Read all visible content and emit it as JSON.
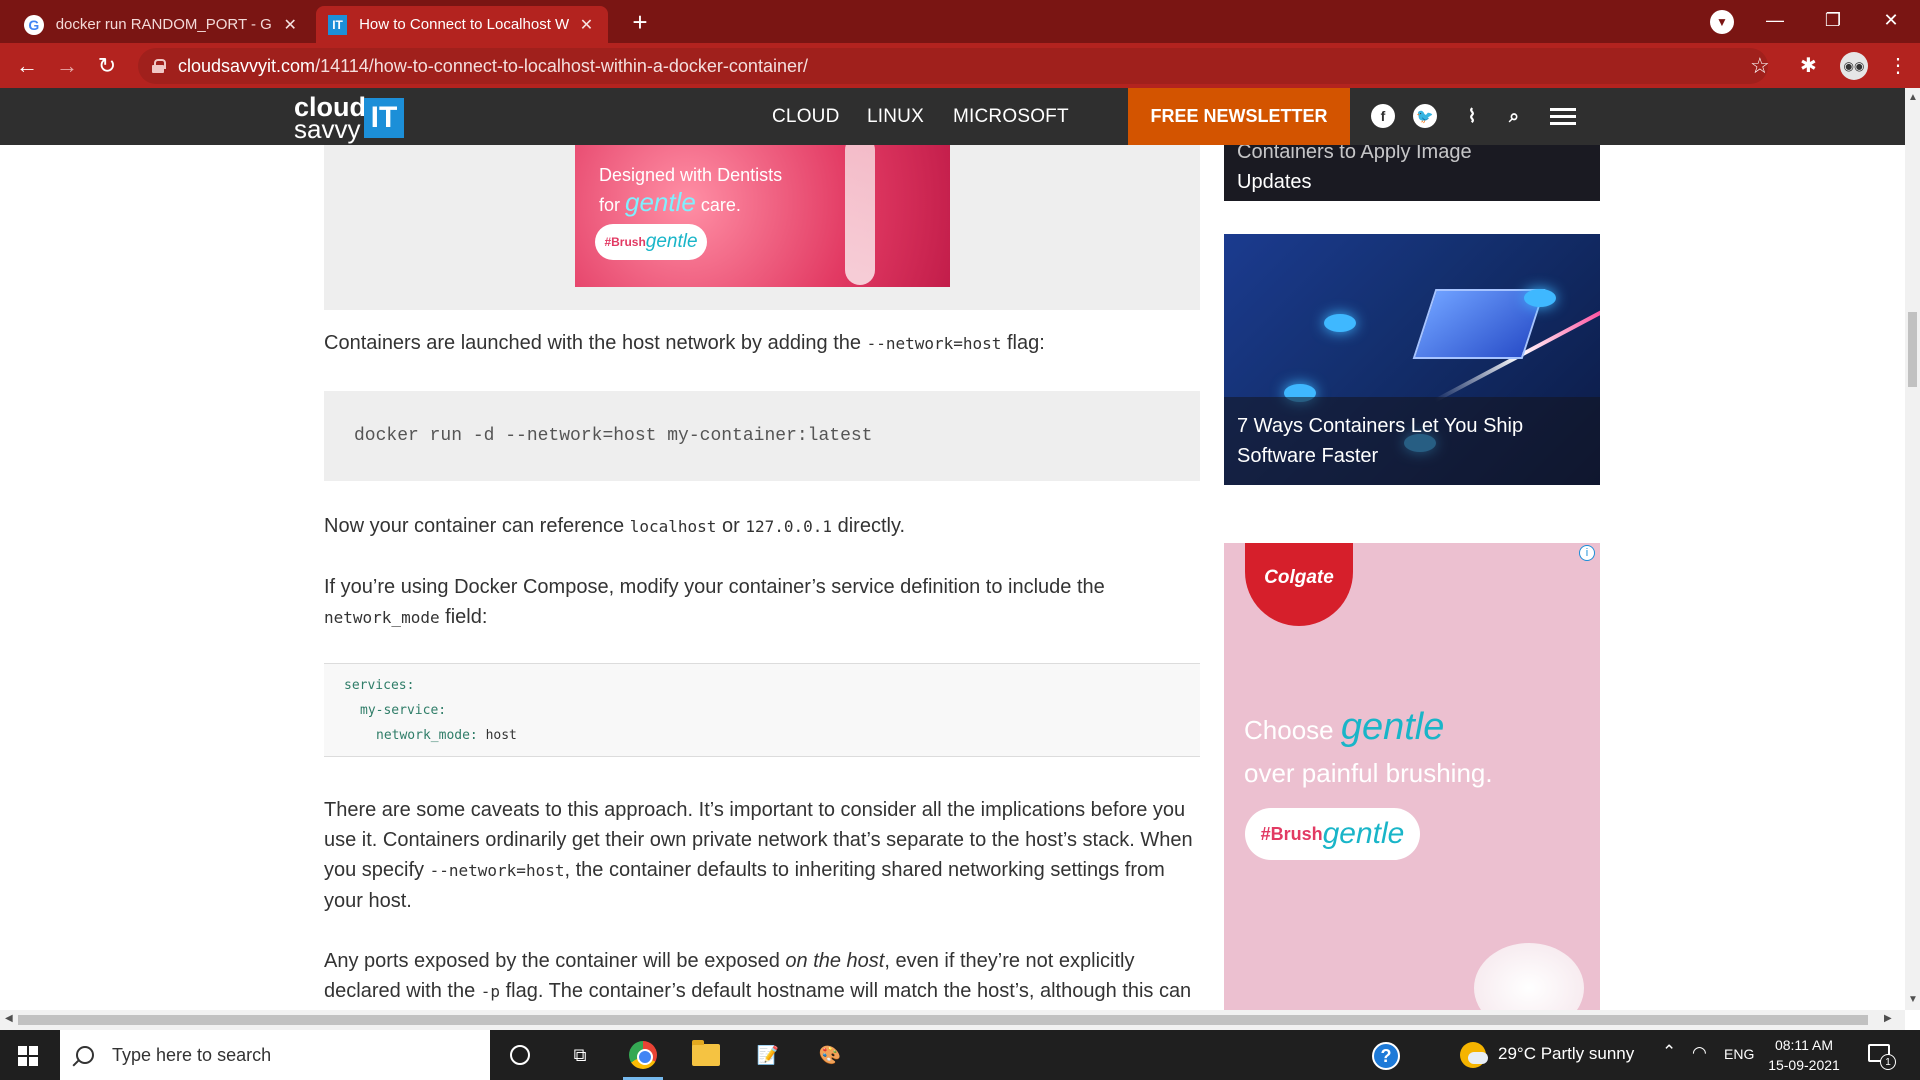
{
  "browser": {
    "tabs": [
      {
        "title": "docker run RANDOM_PORT - Go",
        "favicon": "google-icon",
        "active": false
      },
      {
        "title": "How to Connect to Localhost Wit",
        "favicon": "cloudsavvyit-icon",
        "active": true
      }
    ],
    "address_domain": "cloudsavvyit.com",
    "address_path": "/14114/how-to-connect-to-localhost-within-a-docker-container/",
    "new_tab_label": "+",
    "colors": {
      "tabbar": "#7a1513",
      "toolbar": "#b3231f"
    }
  },
  "site": {
    "logo": {
      "line1": "cloud",
      "line2": "savvy",
      "mark": "IT"
    },
    "nav": [
      "CLOUD",
      "LINUX",
      "MICROSOFT"
    ],
    "newsletter": "FREE NEWSLETTER",
    "social": [
      "facebook-icon",
      "twitter-icon",
      "rss-icon",
      "search-icon",
      "menu-icon"
    ],
    "accent": "#d35400"
  },
  "top_ad": {
    "line1": "Designed with Dentists",
    "line2_pre": "for ",
    "line2_brand": "gentle",
    "line2_post": " care.",
    "hashtag_pre": "#Brush",
    "hashtag_brand": "gentle"
  },
  "article": {
    "p1_pre": "Containers are launched with the host network by adding the ",
    "p1_code": "--network=host",
    "p1_post": " flag:",
    "code1": "docker run -d --network=host my-container:latest",
    "p2_pre": "Now your container can reference ",
    "p2_code1": "localhost",
    "p2_mid": " or ",
    "p2_code2": "127.0.0.1",
    "p2_post": " directly.",
    "p3_pre": "If you’re using Docker Compose, modify your container’s service definition to include the ",
    "p3_code": "network_mode",
    "p3_post": " field:",
    "yaml": {
      "l1_key": "services:",
      "l2_key": "my-service:",
      "l3_key": "network_mode:",
      "l3_val": " host"
    },
    "p4_a": "There are some caveats to this approach. It’s important to consider all the implications before you use it. Containers ordinarily get their own private network that’s separate to the host’s stack. When you specify ",
    "p4_code": "--network=host",
    "p4_b": ", the container defaults to inheriting shared networking settings from your host.",
    "p5_a": "Any ports exposed by the container will be exposed ",
    "p5_em": "on the host",
    "p5_b": ", even if they’re not explicitly declared with the ",
    "p5_code": "-p",
    "p5_c": " flag. The container’s default hostname will match the host’s, although this can"
  },
  "sidebar": {
    "card_top_line1": "Containers to Apply Image",
    "card_top_line2": "Updates",
    "card2_line1": "7 Ways Containers Let You Ship",
    "card2_line2": "Software Faster",
    "ad": {
      "brand": "Colgate",
      "choose": "Choose ",
      "brand_word": "gentle",
      "over": "over painful brushing.",
      "hashtag_pre": "#Brush",
      "hashtag_brand": "gentle",
      "info": "i"
    }
  },
  "taskbar": {
    "search_placeholder": "Type here to search",
    "weather": "29°C  Partly sunny",
    "lang": "ENG",
    "time": "08:11 AM",
    "date": "15-09-2021",
    "notifications": "1"
  }
}
